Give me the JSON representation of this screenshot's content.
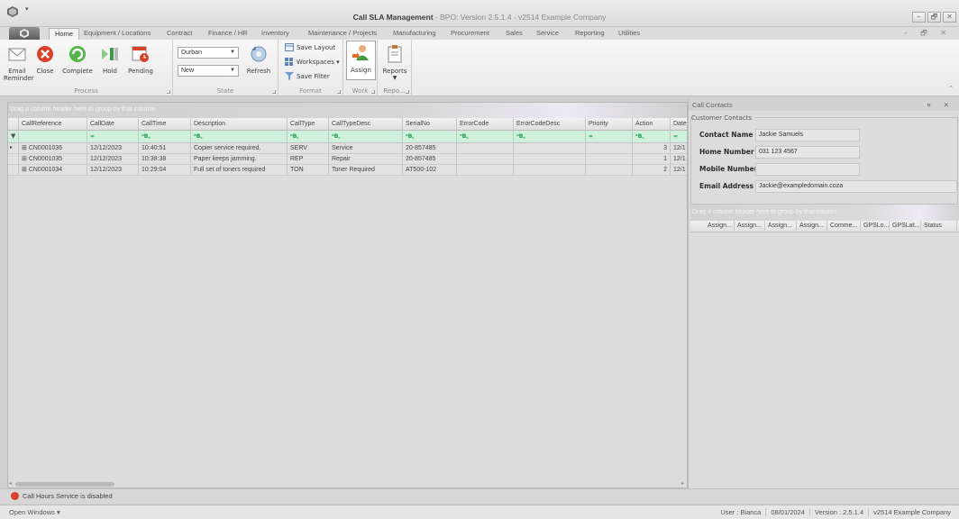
{
  "window": {
    "title_main": "Call SLA Management",
    "title_sub": " - BPO: Version 2.5.1.4 - v2514 Example Company",
    "minimize": "–",
    "maximize": "🗗",
    "close": "✕"
  },
  "tabs": [
    "Home",
    "Equipment / Locations",
    "Contract",
    "Finance / HR",
    "Inventory",
    "Maintenance / Projects",
    "Manufacturing",
    "Procurement",
    "Sales",
    "Service",
    "Reporting",
    "Utilities"
  ],
  "ribbon": {
    "process": {
      "label": "Process",
      "email_reminder": "Email\nReminder",
      "close": "Close",
      "complete": "Complete",
      "hold": "Hold",
      "pending": "Pending"
    },
    "state": {
      "label": "State",
      "branch_value": "Durban",
      "status_value": "New",
      "refresh": "Refresh"
    },
    "format": {
      "label": "Format",
      "save_layout": "Save Layout",
      "workspaces": "Workspaces ▾",
      "save_filter": "Save Filter"
    },
    "work": {
      "label": "Work",
      "assign": "Assign"
    },
    "reports": {
      "label": "Repo...",
      "reports": "Reports"
    }
  },
  "grid": {
    "group_hint": "Drag a column header here to group by that column",
    "columns": [
      "CallReference",
      "CallDate",
      "CallTime",
      "Description",
      "CallType",
      "CallTypeDesc",
      "SerialNo",
      "ErrorCode",
      "ErrorCodeDesc",
      "Priority",
      "Action",
      "Date"
    ],
    "filter_symbols": [
      "",
      "=",
      "ᵃB꜀",
      "ᵃB꜀",
      "ᵃB꜀",
      "ᵃB꜀",
      "ᵃB꜀",
      "ᵃB꜀",
      "ᵃB꜀",
      "=",
      "ᵃB꜀",
      "="
    ],
    "rows": [
      {
        "ref": "CN0001036",
        "date": "12/12/2023",
        "time": "10:40:51",
        "desc": "Copier service required.",
        "type": "SERV",
        "type_desc": "Service",
        "serial": "20-857485",
        "error": "",
        "error_desc": "",
        "priority": "",
        "action": "3",
        "date2": "12/1"
      },
      {
        "ref": "CN0001035",
        "date": "12/12/2023",
        "time": "10:38:38",
        "desc": "Paper keeps jamming.",
        "type": "REP",
        "type_desc": "Repair",
        "serial": "20-857485",
        "error": "",
        "error_desc": "",
        "priority": "",
        "action": "1",
        "date2": "12/1"
      },
      {
        "ref": "CN0001034",
        "date": "12/12/2023",
        "time": "10:29:04",
        "desc": "Full set of toners required",
        "type": "TON",
        "type_desc": "Toner Required",
        "serial": "AT500-102",
        "error": "",
        "error_desc": "",
        "priority": "",
        "action": "2",
        "date2": "12/1"
      }
    ]
  },
  "contacts": {
    "panel_title": "Call Contacts",
    "group_title": "Customer Contacts",
    "fields": [
      {
        "label": "Contact Name",
        "value": "Jackie Samuels"
      },
      {
        "label": "Home Number",
        "value": "031 123 4567"
      },
      {
        "label": "Mobile Number",
        "value": ""
      },
      {
        "label": "Email Address",
        "value": "Jackie@exampledomain.coza"
      }
    ],
    "group_hint": "Drag a column header here to group by that column",
    "columns": [
      "Assign...",
      "Assign...",
      "Assign...",
      "Assign...",
      "Comme...",
      "GPSLo...",
      "GPSLat...",
      "Status"
    ]
  },
  "status": {
    "service": "Call Hours Service is disabled",
    "open_windows": "Open Windows ▾",
    "user": "User : Bianca",
    "date": "08/01/2024",
    "version": "Version : 2.5.1.4",
    "company": "v2514 Example Company"
  },
  "colors": {
    "filter_row": "#cff0da",
    "accent_red": "#d9412b",
    "accent_green": "#1a9c45"
  }
}
